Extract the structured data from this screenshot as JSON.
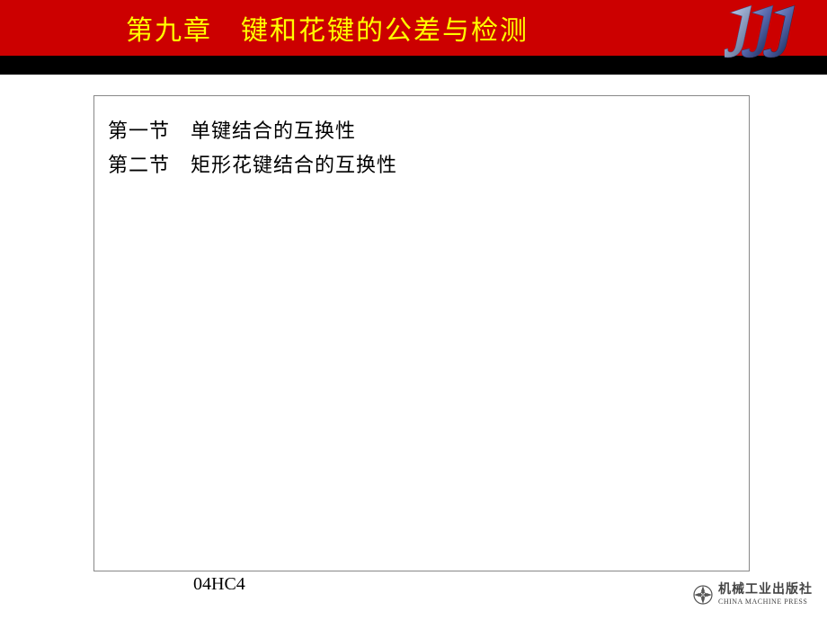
{
  "header": {
    "chapter_title": "第九章　键和花键的公差与检测"
  },
  "content": {
    "section1": "第一节　单键结合的互换性",
    "section2": "第二节　矩形花键结合的互换性"
  },
  "footer": {
    "code": "04HC4",
    "publisher_cn": "机械工业出版社",
    "publisher_en": "CHINA MACHINE PRESS"
  },
  "logo": {
    "letter": "J"
  }
}
